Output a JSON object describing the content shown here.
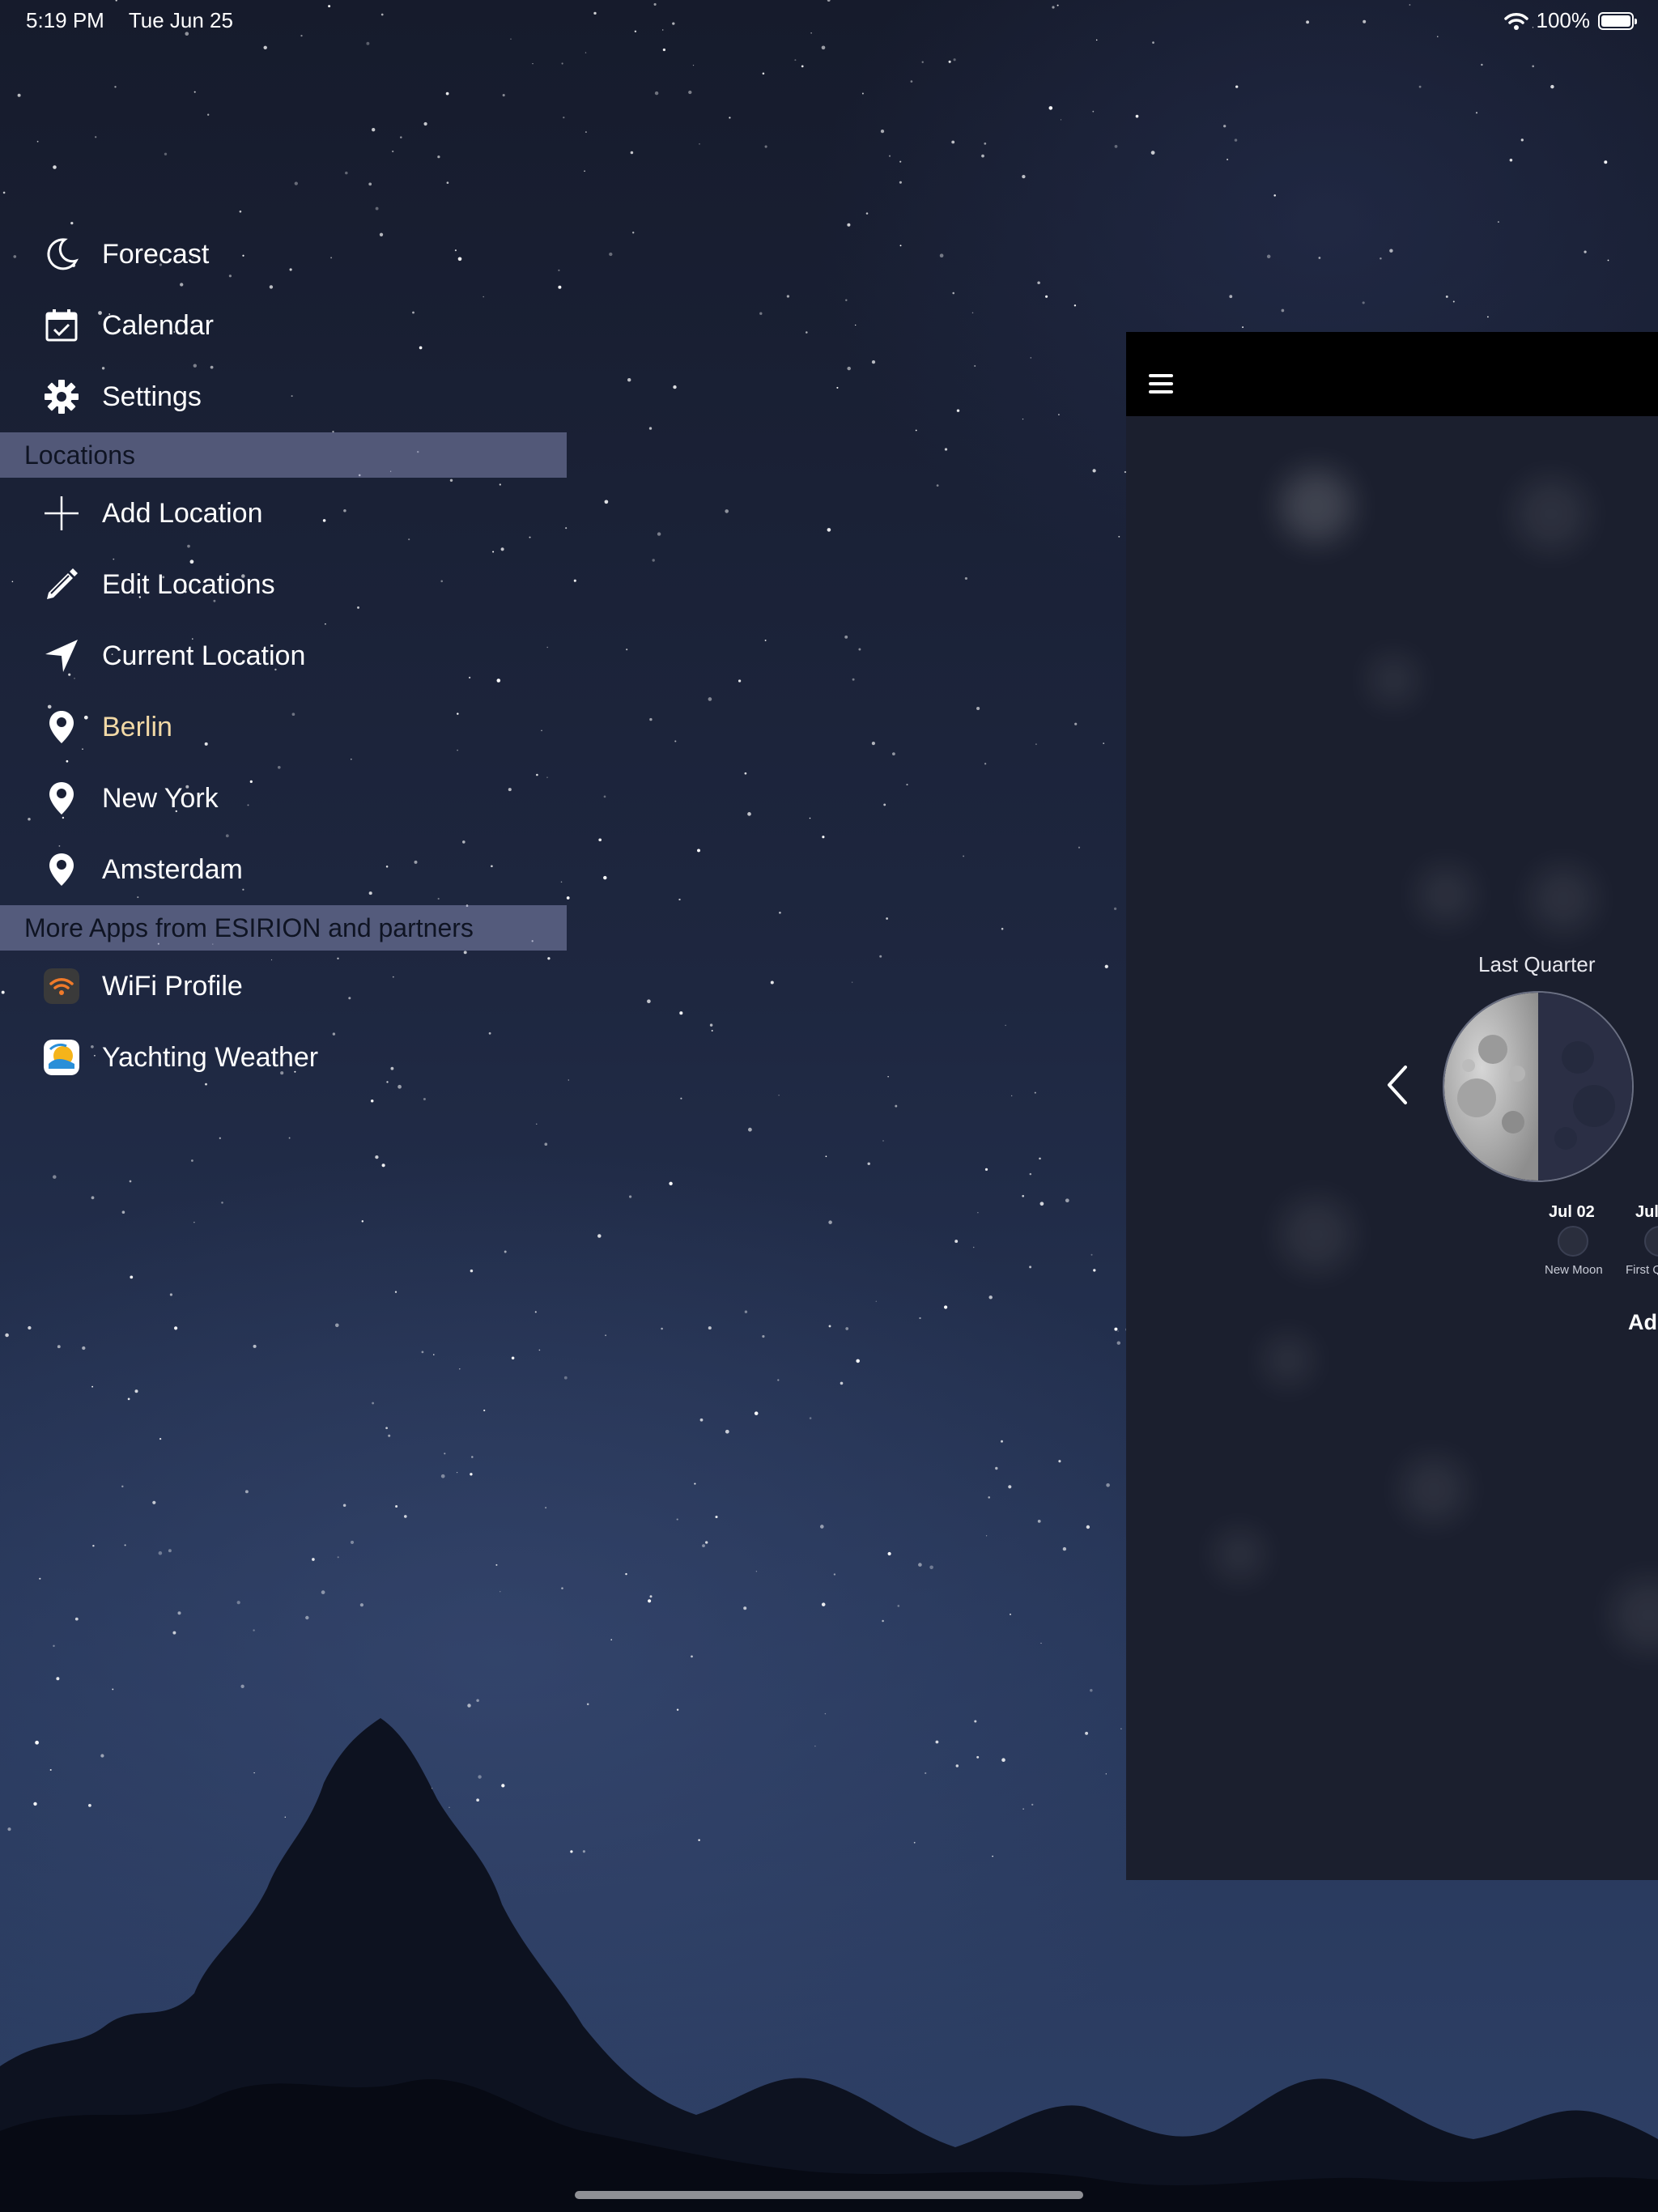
{
  "status_bar": {
    "time": "5:19 PM",
    "date": "Tue Jun 25",
    "battery": "100%"
  },
  "menu": {
    "items": [
      {
        "label": "Forecast",
        "icon": "moon-icon"
      },
      {
        "label": "Calendar",
        "icon": "calendar-icon"
      },
      {
        "label": "Settings",
        "icon": "gear-icon"
      }
    ],
    "locations_header": "Locations",
    "locations": [
      {
        "label": "Add Location",
        "icon": "plus-icon"
      },
      {
        "label": "Edit Locations",
        "icon": "pencil-icon"
      },
      {
        "label": "Current Location",
        "icon": "location-arrow-icon"
      },
      {
        "label": "Berlin",
        "icon": "pin-icon",
        "active": true,
        "active_color": "#f2d9a6"
      },
      {
        "label": "New York",
        "icon": "pin-icon"
      },
      {
        "label": "Amsterdam",
        "icon": "pin-icon"
      }
    ],
    "more_apps_header": "More Apps from ESIRION and partners",
    "apps": [
      {
        "label": "WiFi Profile",
        "icon": "wifi-app-icon"
      },
      {
        "label": "Yachting Weather",
        "icon": "yachting-weather-app-icon"
      }
    ]
  },
  "panel": {
    "phase_title": "Last Quarter",
    "next_phases": [
      {
        "date": "Jul 02",
        "label": "New Moon"
      },
      {
        "date": "Jul",
        "label": "First Q"
      }
    ],
    "ad_text": "Ad"
  }
}
